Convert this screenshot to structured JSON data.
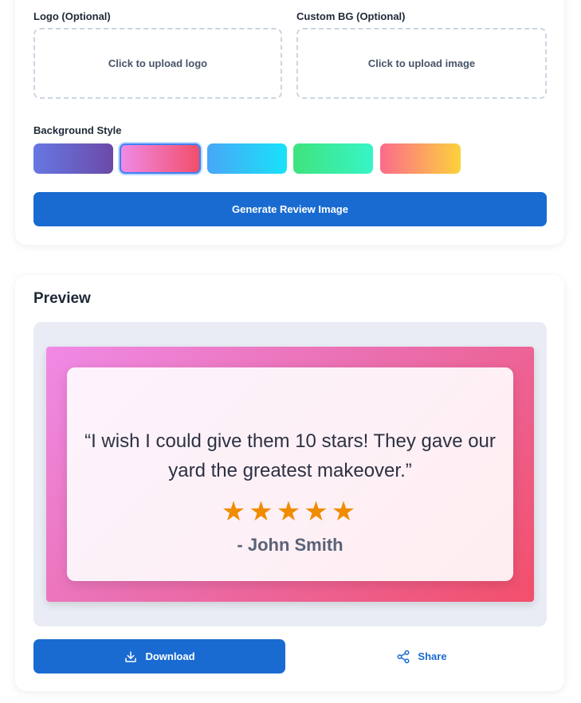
{
  "settings": {
    "logo_label": "Logo (Optional)",
    "logo_upload_text": "Click to upload logo",
    "bg_label": "Custom BG (Optional)",
    "bg_upload_text": "Click to upload image",
    "style_label": "Background Style",
    "swatches": [
      {
        "name": "purple-indigo",
        "from": "#6777e3",
        "to": "#6b4aa8",
        "selected": false
      },
      {
        "name": "pink-red",
        "from": "#f08ae6",
        "to": "#f24f6a",
        "selected": true
      },
      {
        "name": "blue-cyan",
        "from": "#48a7f7",
        "to": "#19e2f9",
        "selected": false
      },
      {
        "name": "green-teal",
        "from": "#3fe37d",
        "to": "#37f5c7",
        "selected": false
      },
      {
        "name": "coral-yellow",
        "from": "#fb6b8c",
        "to": "#fcd23c",
        "selected": false
      }
    ],
    "generate_label": "Generate Review Image"
  },
  "preview": {
    "title": "Preview",
    "quote": "“I wish I could give them 10 stars! They gave our yard the greatest makeover.”",
    "stars": "★★★★★",
    "rating": 5,
    "author": "- John Smith",
    "download_label": "Download",
    "share_label": "Share"
  },
  "colors": {
    "accent": "#1a6bd1",
    "star": "#f08c00"
  }
}
